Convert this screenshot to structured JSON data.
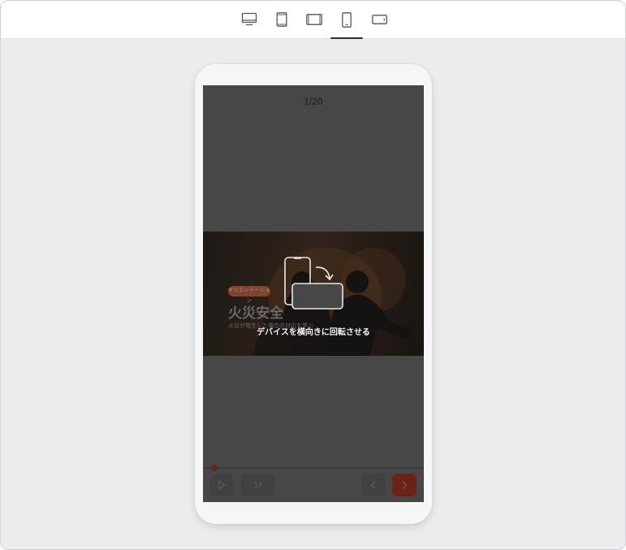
{
  "toolbar": {
    "devices": [
      {
        "name": "desktop",
        "icon": "monitor-icon",
        "active": false
      },
      {
        "name": "tablet-portrait",
        "icon": "tablet-portrait-icon",
        "active": false
      },
      {
        "name": "tablet-landscape",
        "icon": "tablet-landscape-icon",
        "active": false
      },
      {
        "name": "mobile-portrait",
        "icon": "phone-portrait-icon",
        "active": true
      },
      {
        "name": "mobile-landscape",
        "icon": "phone-landscape-icon",
        "active": false
      }
    ]
  },
  "player": {
    "page_counter": "1/20",
    "slide": {
      "badge": "オリエンテーション",
      "title": "火災安全",
      "subtitle": "火災が発生した場合の対応を学ぶ"
    },
    "rotate_message": "デバイスを横向きに回転させる",
    "progress": 0.05,
    "speed_label": "1x",
    "accent_color": "#6a2219"
  },
  "colors": {
    "background": "#ebecee",
    "screen_overlay": "#474747",
    "active_indicator": "#2b2d33"
  }
}
